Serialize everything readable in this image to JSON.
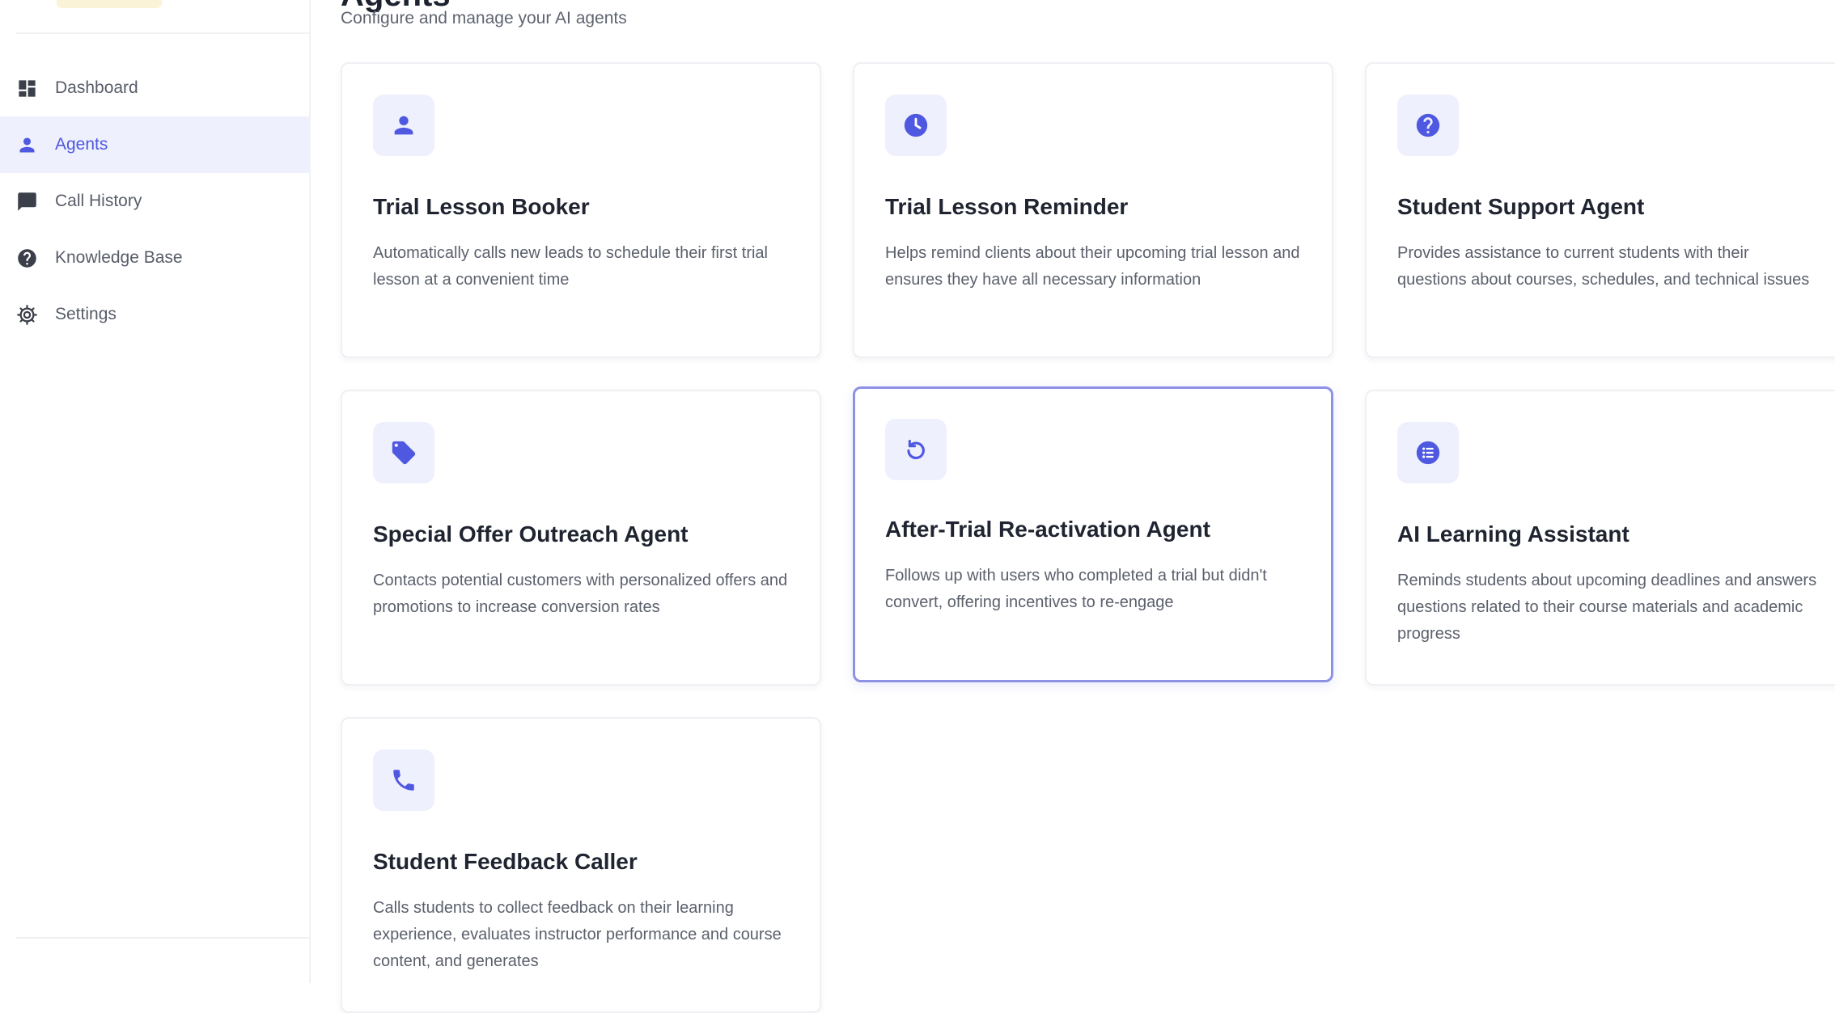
{
  "sidebar": {
    "items": [
      {
        "label": "Dashboard",
        "icon": "dashboard-icon",
        "active": false
      },
      {
        "label": "Agents",
        "icon": "person-icon",
        "active": true
      },
      {
        "label": "Call History",
        "icon": "chat-icon",
        "active": false
      },
      {
        "label": "Knowledge Base",
        "icon": "help-circle-icon",
        "active": false
      },
      {
        "label": "Settings",
        "icon": "gear-icon",
        "active": false
      }
    ]
  },
  "header": {
    "title": "Agents",
    "subtitle": "Configure and manage your AI agents"
  },
  "agents": [
    {
      "title": "Trial Lesson Booker",
      "description": "Automatically calls new leads to schedule their first trial lesson at a convenient time",
      "icon": "person-icon"
    },
    {
      "title": "Trial Lesson Reminder",
      "description": "Helps remind clients about their upcoming trial lesson and ensures they have all necessary information",
      "icon": "clock-icon"
    },
    {
      "title": "Student Support Agent",
      "description": "Provides assistance to current students with their questions about courses, schedules, and technical issues",
      "icon": "question-icon"
    },
    {
      "title": "Special Offer Outreach Agent",
      "description": "Contacts potential customers with personalized offers and promotions to increase conversion rates",
      "icon": "tag-icon"
    },
    {
      "title": "After-Trial Re-activation Agent",
      "description": "Follows up with users who completed a trial but didn't convert, offering incentives to re-engage",
      "icon": "refresh-icon",
      "selected": true
    },
    {
      "title": "AI Learning Assistant",
      "description": "Reminds students about upcoming deadlines and answers questions related to their course materials and academic progress",
      "icon": "list-icon"
    },
    {
      "title": "Student Feedback Caller",
      "description": "Calls students to collect feedback on their learning experience, evaluates instructor performance and course content, and generates",
      "icon": "phone-icon"
    }
  ],
  "colors": {
    "accent": "#4f58e0",
    "active_bg": "#eef0fd",
    "icon_bg": "#eef0fd",
    "selected_border": "#8c91e4",
    "card_border": "#eef0f4",
    "nav_icon": "#3b3f49"
  }
}
